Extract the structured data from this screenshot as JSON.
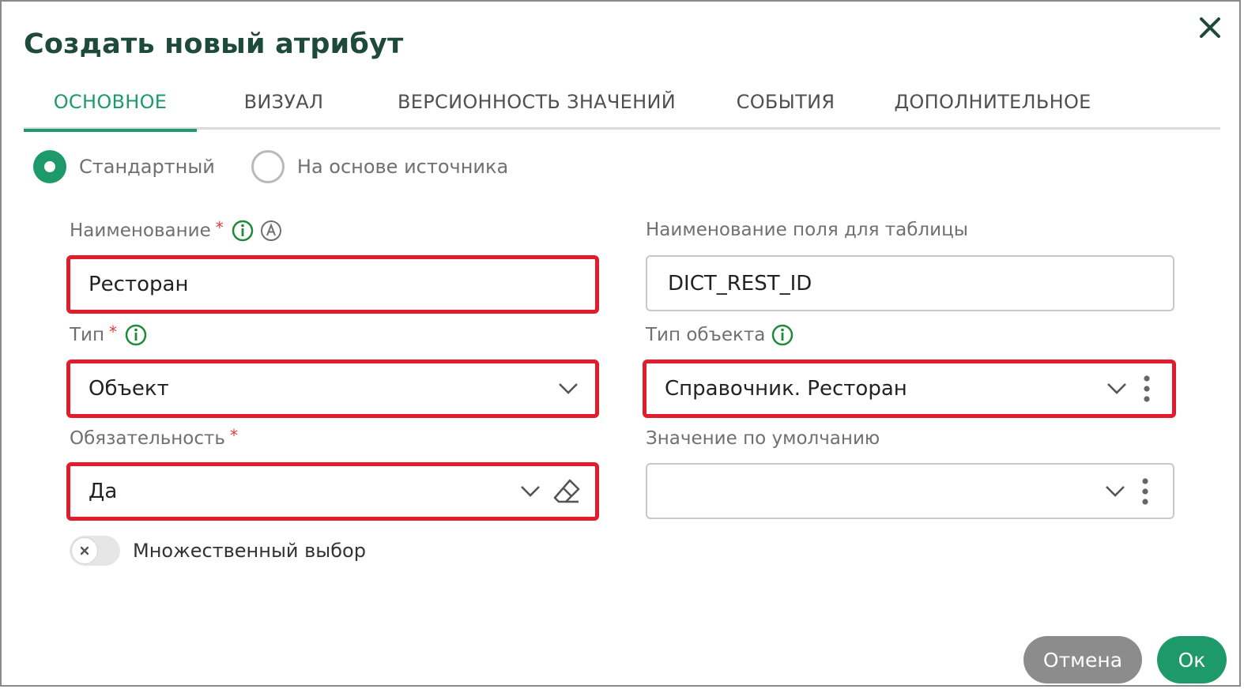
{
  "dialog": {
    "title": "Создать новый атрибут"
  },
  "tabs": [
    {
      "label": "ОСНОВНОЕ",
      "active": true
    },
    {
      "label": "ВИЗУАЛ",
      "active": false
    },
    {
      "label": "ВЕРСИОННОСТЬ ЗНАЧЕНИЙ",
      "active": false
    },
    {
      "label": "СОБЫТИЯ",
      "active": false
    },
    {
      "label": "ДОПОЛНИТЕЛЬНОЕ",
      "active": false
    }
  ],
  "mode": {
    "options": [
      {
        "label": "Стандартный",
        "checked": true
      },
      {
        "label": "На основе источника",
        "checked": false
      }
    ]
  },
  "fields": {
    "name": {
      "label": "Наименование",
      "required_mark": "*",
      "value": "Ресторан"
    },
    "table_field": {
      "label": "Наименование поля для таблицы",
      "value": "DICT_REST_ID"
    },
    "type": {
      "label": "Тип",
      "required_mark": "*",
      "value": "Объект"
    },
    "object_type": {
      "label": "Тип объекта",
      "value": "Справочник. Ресторан"
    },
    "mandatory": {
      "label": "Обязательность",
      "required_mark": "*",
      "value": "Да"
    },
    "default_value": {
      "label": "Значение по умолчанию",
      "value": ""
    }
  },
  "multiple_choice": {
    "label": "Множественный выбор",
    "enabled": false
  },
  "buttons": {
    "cancel": "Отмена",
    "ok": "Ок"
  },
  "colors": {
    "accent": "#1e9a6a",
    "title": "#1e4a3c",
    "highlight": "#e11c2c",
    "required": "#e23b3b",
    "cancel_bg": "#8c8c8c"
  }
}
